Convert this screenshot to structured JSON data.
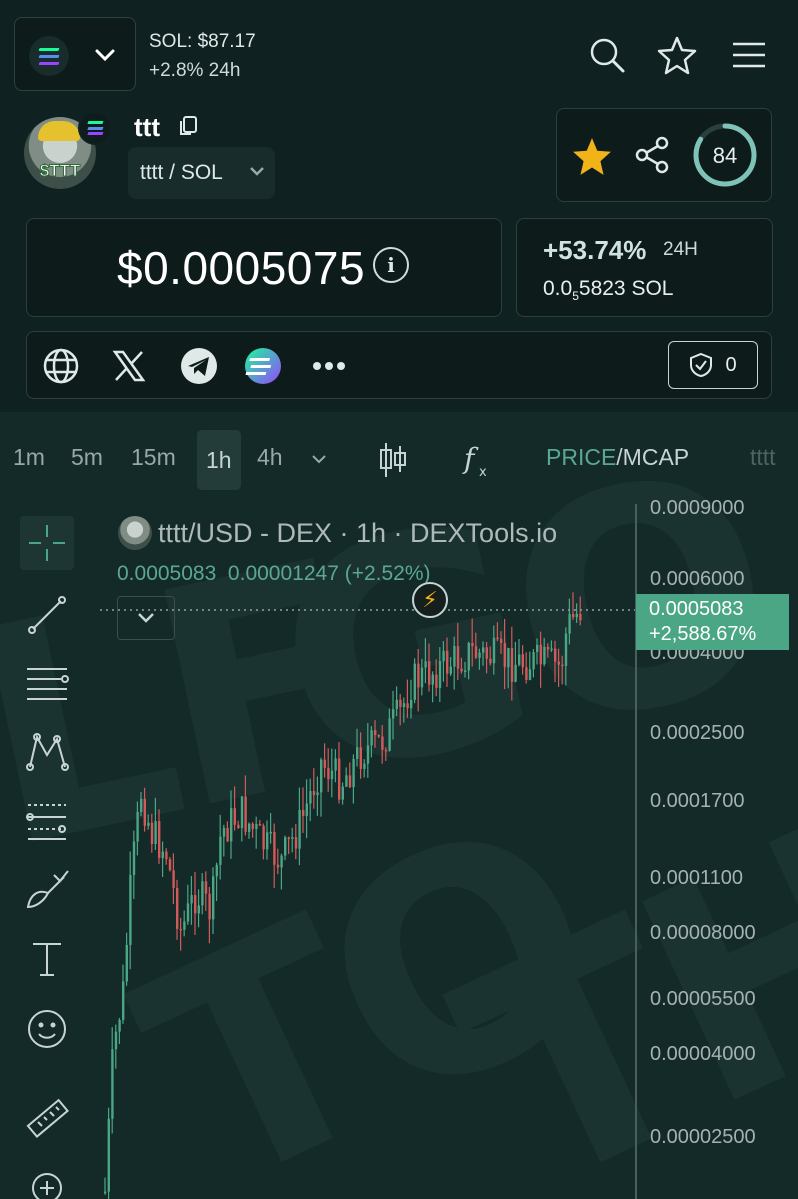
{
  "header": {
    "sol_price": "SOL: $87.17",
    "sol_change": "+2.8% 24h",
    "chain_colors": [
      "#19fb9b",
      "#3d8bf0",
      "#9945ff"
    ]
  },
  "token": {
    "name": "ttt",
    "pair": "tttt / SOL",
    "avatar_label": "$TTT",
    "score": "84",
    "score_fraction": 0.84
  },
  "price": {
    "usd": "$0.0005075",
    "change_pct": "+53.74%",
    "change_period": "24H",
    "sol_prefix": "0.0",
    "sol_sub": "5",
    "sol_suffix": "5823 SOL"
  },
  "links": {
    "shield_count": "0"
  },
  "chart": {
    "timeframes": [
      "1m",
      "5m",
      "15m",
      "1h",
      "4h"
    ],
    "active_timeframe": "1h",
    "price_label": "PRICE",
    "mcap_label": "/MCAP",
    "extra_tab": "tttt",
    "title": "tttt/USD - DEX · 1h · DEXTools.io",
    "ohlc_values": "0.0005083  0.00001247 (+2.52%)",
    "current_price": "0.0005083",
    "current_change": "+2,588.67%",
    "y_labels": [
      "0.0009000",
      "0.0006000",
      "0.0004000",
      "0.0002500",
      "0.0001700",
      "0.0001100",
      "0.00008000",
      "0.00005500",
      "0.00004000",
      "0.00002500"
    ],
    "up_color": "#4aa685",
    "down_color": "#d25a5a"
  }
}
